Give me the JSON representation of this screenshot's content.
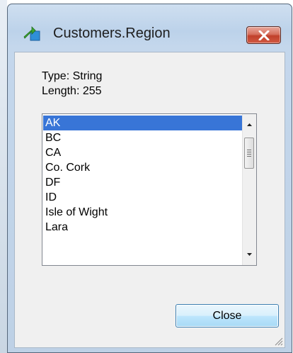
{
  "window": {
    "title": "Customers.Region",
    "close_glyph": "✕",
    "icon": "field-arrow-icon"
  },
  "field": {
    "type_text": "Type: String",
    "length_text": "Length: 255"
  },
  "list": {
    "items": [
      "AK",
      "BC",
      "CA",
      "Co. Cork",
      "DF",
      "ID",
      "Isle of Wight",
      "Lara"
    ],
    "selected": "AK"
  },
  "buttons": {
    "close_label": "Close"
  },
  "colors": {
    "selection": "#3875d7",
    "title_close": "#c7432e"
  }
}
